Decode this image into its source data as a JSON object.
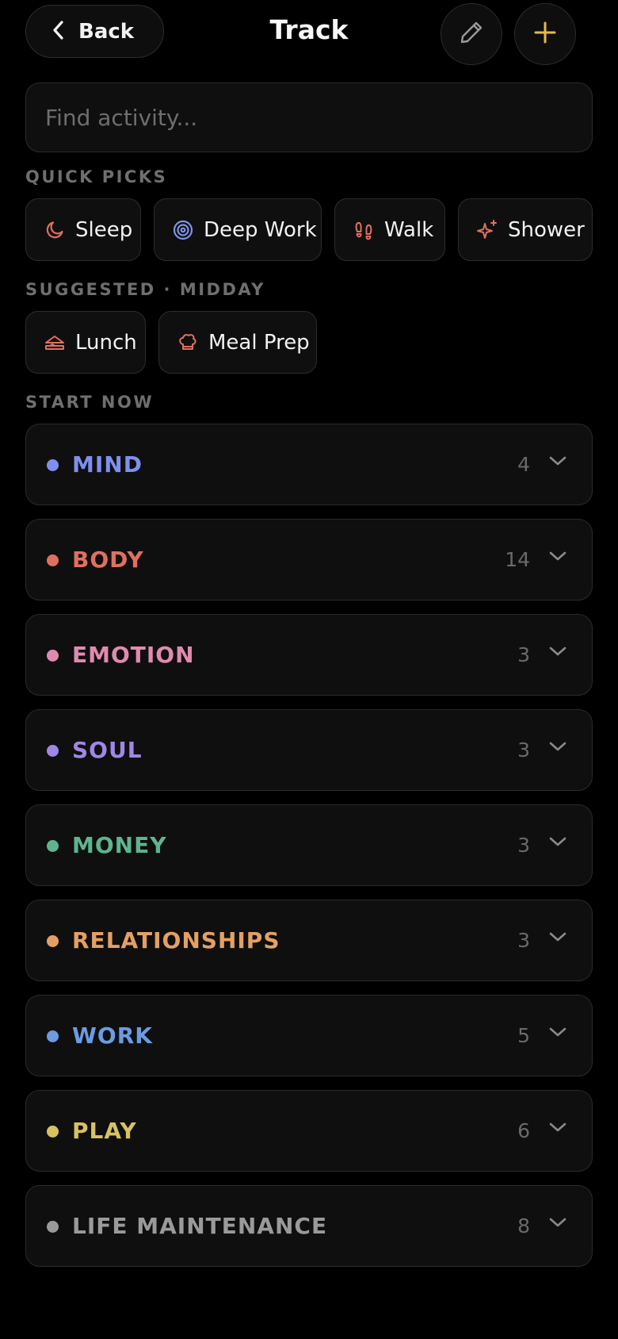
{
  "header": {
    "back_label": "Back",
    "title": "Track",
    "edit_icon": "pencil-icon",
    "add_icon": "plus-icon"
  },
  "search": {
    "placeholder": "Find activity..."
  },
  "quick_picks": {
    "label": "QUICK PICKS",
    "items": [
      {
        "label": "Sleep",
        "icon": "moon-icon",
        "color": "#e0705e"
      },
      {
        "label": "Deep Work",
        "icon": "target-icon",
        "color": "#7f93e6"
      },
      {
        "label": "Walk",
        "icon": "footprints-icon",
        "color": "#e0705e"
      },
      {
        "label": "Shower",
        "icon": "sparkles-icon",
        "color": "#e0705e"
      }
    ]
  },
  "suggested": {
    "label": "SUGGESTED · MIDDAY",
    "items": [
      {
        "label": "Lunch",
        "icon": "sandwich-icon",
        "color": "#e0705e"
      },
      {
        "label": "Meal Prep",
        "icon": "chef-hat-icon",
        "color": "#e0705e"
      }
    ]
  },
  "start_now": {
    "label": "START NOW",
    "categories": [
      {
        "name": "MIND",
        "count": "4",
        "color": "#7f8ff0"
      },
      {
        "name": "BODY",
        "count": "14",
        "color": "#e0705e"
      },
      {
        "name": "EMOTION",
        "count": "3",
        "color": "#e18ab0"
      },
      {
        "name": "SOUL",
        "count": "3",
        "color": "#a086e6"
      },
      {
        "name": "MONEY",
        "count": "3",
        "color": "#5fb48f"
      },
      {
        "name": "RELATIONSHIPS",
        "count": "3",
        "color": "#e4a064"
      },
      {
        "name": "WORK",
        "count": "5",
        "color": "#6c9be2"
      },
      {
        "name": "PLAY",
        "count": "6",
        "color": "#d8c163"
      },
      {
        "name": "LIFE MAINTENANCE",
        "count": "8",
        "color": "#9a9a9a"
      }
    ]
  },
  "colors": {
    "accent_plus": "#e8b84c",
    "background": "#000000",
    "card": "#0f0f0f"
  }
}
